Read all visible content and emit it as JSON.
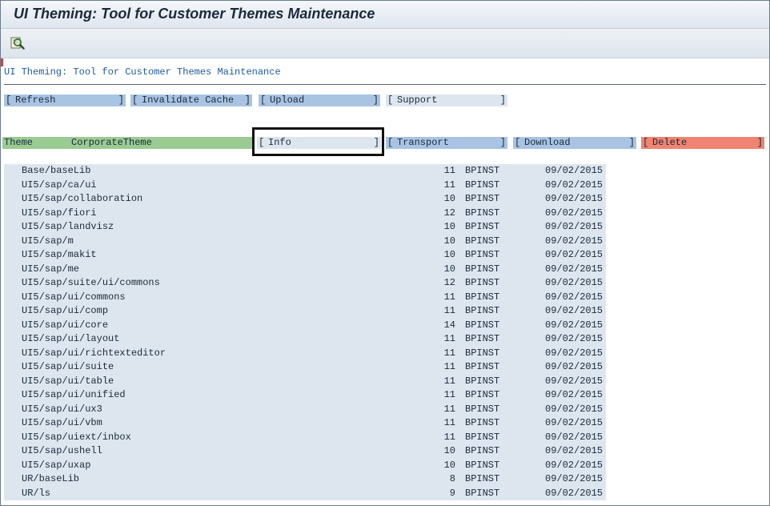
{
  "window": {
    "title": "UI Theming: Tool for Customer Themes Maintenance"
  },
  "toolbar": {
    "icon": "execute-search-icon"
  },
  "subtitle": "UI Theming: Tool for Customer Themes Maintenance",
  "buttons": {
    "refresh": "Refresh",
    "invalidate_cache": "Invalidate Cache",
    "upload": "Upload",
    "support": "Support",
    "info": "Info",
    "transport": "Transport",
    "download": "Download",
    "delete": "Delete"
  },
  "theme": {
    "label": "Theme",
    "value": "CorporateTheme"
  },
  "colors": {
    "button_blue": "#a9c4e2",
    "button_grey": "#dde6ef",
    "button_delete": "#ee8471",
    "theme_green": "#9acb93",
    "subtitle_blue": "#1e5a9c"
  },
  "rows": [
    {
      "path": "Base/baseLib",
      "count": "11",
      "user": "BPINST",
      "date": "09/02/2015"
    },
    {
      "path": "UI5/sap/ca/ui",
      "count": "11",
      "user": "BPINST",
      "date": "09/02/2015"
    },
    {
      "path": "UI5/sap/collaboration",
      "count": "10",
      "user": "BPINST",
      "date": "09/02/2015"
    },
    {
      "path": "UI5/sap/fiori",
      "count": "12",
      "user": "BPINST",
      "date": "09/02/2015"
    },
    {
      "path": "UI5/sap/landvisz",
      "count": "10",
      "user": "BPINST",
      "date": "09/02/2015"
    },
    {
      "path": "UI5/sap/m",
      "count": "10",
      "user": "BPINST",
      "date": "09/02/2015"
    },
    {
      "path": "UI5/sap/makit",
      "count": "10",
      "user": "BPINST",
      "date": "09/02/2015"
    },
    {
      "path": "UI5/sap/me",
      "count": "10",
      "user": "BPINST",
      "date": "09/02/2015"
    },
    {
      "path": "UI5/sap/suite/ui/commons",
      "count": "12",
      "user": "BPINST",
      "date": "09/02/2015"
    },
    {
      "path": "UI5/sap/ui/commons",
      "count": "11",
      "user": "BPINST",
      "date": "09/02/2015"
    },
    {
      "path": "UI5/sap/ui/comp",
      "count": "11",
      "user": "BPINST",
      "date": "09/02/2015"
    },
    {
      "path": "UI5/sap/ui/core",
      "count": "14",
      "user": "BPINST",
      "date": "09/02/2015"
    },
    {
      "path": "UI5/sap/ui/layout",
      "count": "11",
      "user": "BPINST",
      "date": "09/02/2015"
    },
    {
      "path": "UI5/sap/ui/richtexteditor",
      "count": "11",
      "user": "BPINST",
      "date": "09/02/2015"
    },
    {
      "path": "UI5/sap/ui/suite",
      "count": "11",
      "user": "BPINST",
      "date": "09/02/2015"
    },
    {
      "path": "UI5/sap/ui/table",
      "count": "11",
      "user": "BPINST",
      "date": "09/02/2015"
    },
    {
      "path": "UI5/sap/ui/unified",
      "count": "11",
      "user": "BPINST",
      "date": "09/02/2015"
    },
    {
      "path": "UI5/sap/ui/ux3",
      "count": "11",
      "user": "BPINST",
      "date": "09/02/2015"
    },
    {
      "path": "UI5/sap/ui/vbm",
      "count": "11",
      "user": "BPINST",
      "date": "09/02/2015"
    },
    {
      "path": "UI5/sap/uiext/inbox",
      "count": "11",
      "user": "BPINST",
      "date": "09/02/2015"
    },
    {
      "path": "UI5/sap/ushell",
      "count": "10",
      "user": "BPINST",
      "date": "09/02/2015"
    },
    {
      "path": "UI5/sap/uxap",
      "count": "10",
      "user": "BPINST",
      "date": "09/02/2015"
    },
    {
      "path": "UR/baseLib",
      "count": "8",
      "user": "BPINST",
      "date": "09/02/2015"
    },
    {
      "path": "UR/ls",
      "count": "9",
      "user": "BPINST",
      "date": "09/02/2015"
    }
  ]
}
